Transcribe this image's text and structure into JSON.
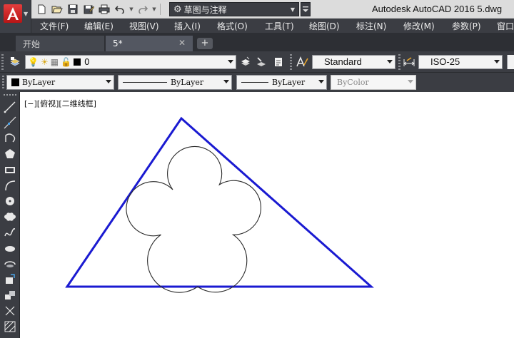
{
  "window": {
    "title": "Autodesk AutoCAD 2016    5.dwg"
  },
  "workspace": {
    "name": "草图与注释"
  },
  "menu": [
    {
      "label": "文件(F)"
    },
    {
      "label": "编辑(E)"
    },
    {
      "label": "视图(V)"
    },
    {
      "label": "插入(I)"
    },
    {
      "label": "格式(O)"
    },
    {
      "label": "工具(T)"
    },
    {
      "label": "绘图(D)"
    },
    {
      "label": "标注(N)"
    },
    {
      "label": "修改(M)"
    },
    {
      "label": "参数(P)"
    },
    {
      "label": "窗口"
    }
  ],
  "tabs": [
    {
      "label": "开始"
    },
    {
      "label": "5*"
    }
  ],
  "layer": {
    "current": "0"
  },
  "styles": {
    "text_style": "Standard",
    "dim_style": "ISO-25"
  },
  "properties": {
    "color": "ByLayer",
    "linetype": "ByLayer",
    "lineweight": "ByLayer",
    "plot_style": "ByColor"
  },
  "viewport": {
    "label": "[−][俯视][二维线框]"
  },
  "drawing": {
    "triangle_color": "#1a1ad1",
    "petal_color": "#2a2a2a",
    "petal_count": 5
  },
  "icons": {
    "quick_access": [
      "new-icon",
      "open-icon",
      "save-icon",
      "save-as-icon",
      "plot-icon",
      "undo-icon",
      "redo-icon"
    ],
    "draw_tools": [
      "line-icon",
      "construction-line-icon",
      "polyline-icon",
      "polygon-icon",
      "rectangle-icon",
      "arc-icon",
      "circle-icon",
      "revision-cloud-icon",
      "spline-icon",
      "ellipse-icon",
      "ellipse-arc-icon",
      "insert-block-icon",
      "make-block-icon",
      "point-icon",
      "hatch-icon"
    ]
  }
}
